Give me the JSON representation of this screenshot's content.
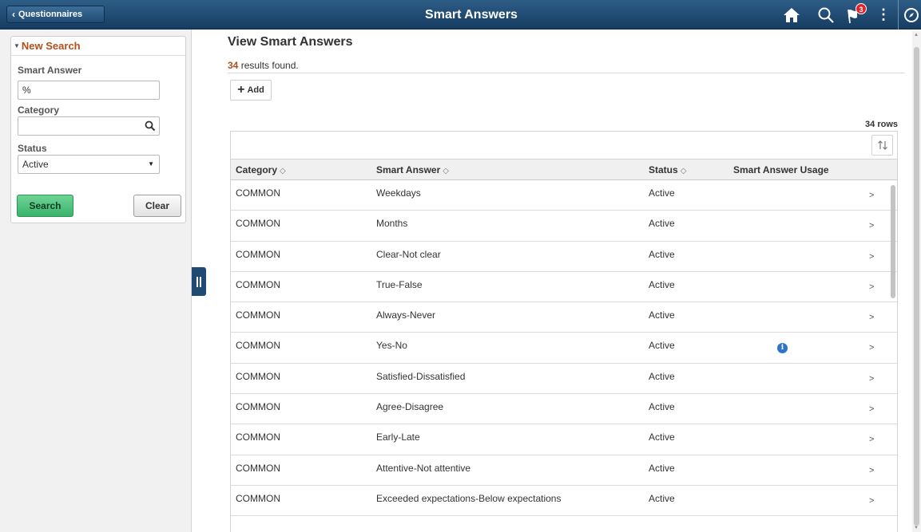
{
  "banner": {
    "back_label": "Questionnaires",
    "title": "Smart Answers",
    "notification_count": "3",
    "kebab": "⋮"
  },
  "search_panel": {
    "header": "New Search",
    "smart_answer_label": "Smart Answer",
    "smart_answer_value": "%",
    "category_label": "Category",
    "category_value": "",
    "status_label": "Status",
    "status_value": "Active",
    "search_button": "Search",
    "clear_button": "Clear"
  },
  "main": {
    "title": "View Smart Answers",
    "results_count": "34",
    "results_suffix": " results found.",
    "add_button": "Add",
    "rows_label": "34 rows",
    "columns": [
      "Category",
      "Smart Answer",
      "Status",
      "Smart Answer Usage"
    ],
    "rows": [
      {
        "category": "COMMON",
        "answer": "Weekdays",
        "status": "Active",
        "info": false
      },
      {
        "category": "COMMON",
        "answer": "Months",
        "status": "Active",
        "info": false
      },
      {
        "category": "COMMON",
        "answer": "Clear-Not clear",
        "status": "Active",
        "info": false
      },
      {
        "category": "COMMON",
        "answer": "True-False",
        "status": "Active",
        "info": false
      },
      {
        "category": "COMMON",
        "answer": "Always-Never",
        "status": "Active",
        "info": false
      },
      {
        "category": "COMMON",
        "answer": "Yes-No",
        "status": "Active",
        "info": true
      },
      {
        "category": "COMMON",
        "answer": "Satisfied-Dissatisfied",
        "status": "Active",
        "info": false
      },
      {
        "category": "COMMON",
        "answer": "Agree-Disagree",
        "status": "Active",
        "info": false
      },
      {
        "category": "COMMON",
        "answer": "Early-Late",
        "status": "Active",
        "info": false
      },
      {
        "category": "COMMON",
        "answer": "Attentive-Not attentive",
        "status": "Active",
        "info": false
      },
      {
        "category": "COMMON",
        "answer": "Exceeded expectations-Below expectations",
        "status": "Active",
        "info": false
      },
      {
        "category": "",
        "answer": "",
        "status": "",
        "info": false
      }
    ]
  },
  "icons": {
    "back": "chevron-left-icon",
    "home": "home-icon",
    "search": "search-icon",
    "notifications": "flag-icon",
    "actions": "kebab-menu-icon",
    "navbar": "compass-icon",
    "lookup": "magnifier-icon",
    "sort": "sort-arrows-icon",
    "info": "info-icon",
    "row_chevron": "chevron-right-icon"
  },
  "colors": {
    "banner": "#1f4b72",
    "accent_orange": "#b14f1a",
    "search_green": "#3ab36b",
    "info_blue": "#2c75c7",
    "notification_red": "#e0232b"
  }
}
